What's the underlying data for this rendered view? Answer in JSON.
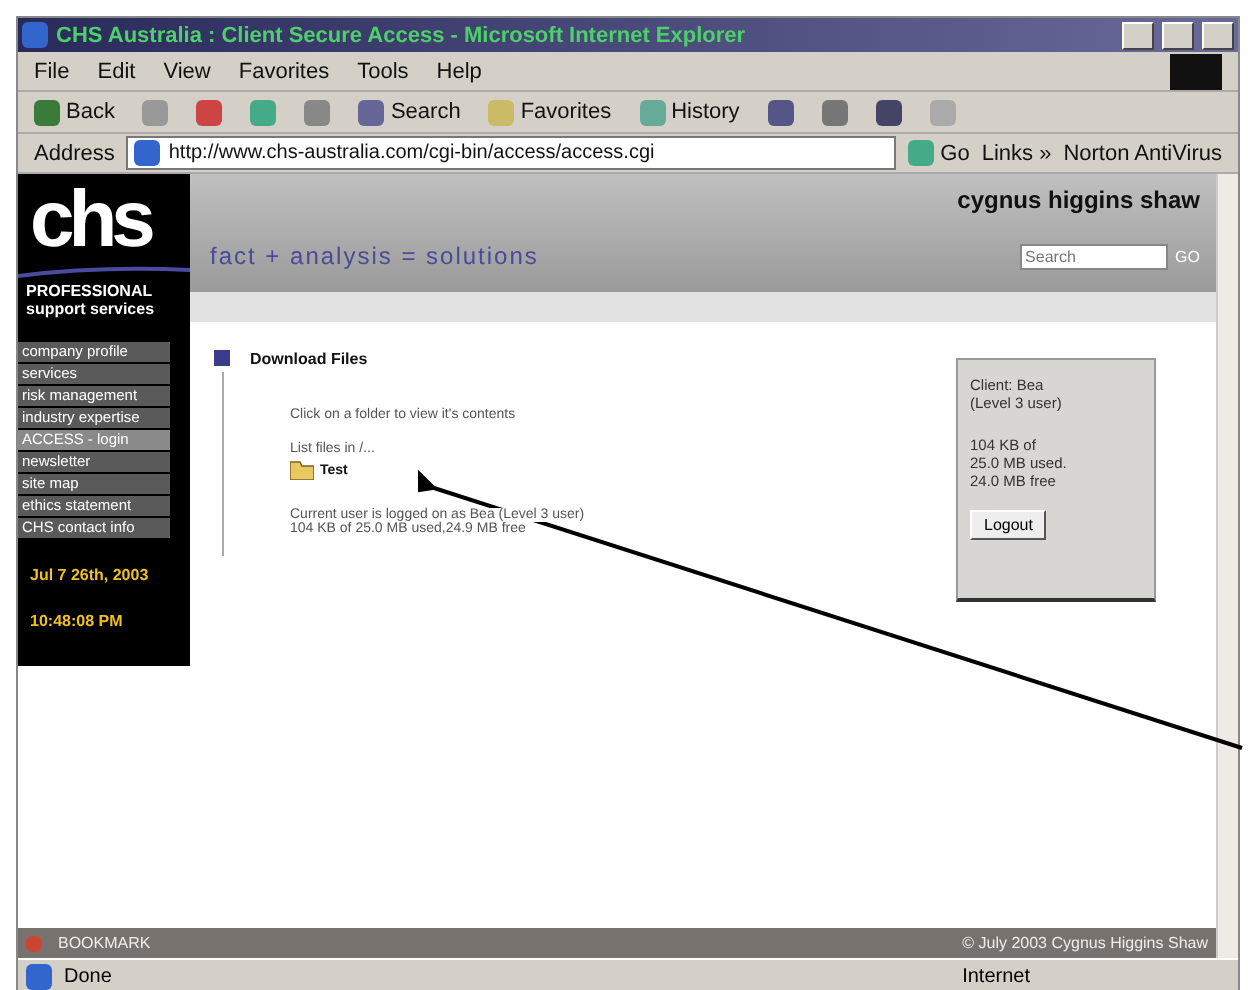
{
  "window": {
    "title": "CHS Australia : Client Secure Access - Microsoft Internet Explorer"
  },
  "menu": [
    "File",
    "Edit",
    "View",
    "Favorites",
    "Tools",
    "Help"
  ],
  "toolbar": [
    {
      "kind": "back",
      "label": "Back"
    },
    {
      "kind": "forward"
    },
    {
      "kind": "stop"
    },
    {
      "kind": "refresh"
    },
    {
      "kind": "home"
    },
    {
      "kind": "search",
      "label": "Search"
    },
    {
      "kind": "favorites",
      "label": "Favorites"
    },
    {
      "kind": "history",
      "label": "History"
    },
    {
      "kind": "mail"
    },
    {
      "kind": "print"
    },
    {
      "kind": "edit"
    },
    {
      "kind": "discuss"
    }
  ],
  "address": {
    "label": "Address",
    "url": "http://www.chs-australia.com/cgi-bin/access/access.cgi",
    "go": "Go",
    "links": "Links",
    "links_more": "»",
    "norton": "Norton AntiVirus"
  },
  "site": {
    "logo": "chs",
    "tagline_1": "PROFESSIONAL",
    "tagline_2": "support services",
    "company": "cygnus higgins shaw",
    "slogan": "fact + analysis = solutions",
    "search_placeholder": "Search",
    "search_button": "GO"
  },
  "nav": [
    {
      "label": "company profile",
      "selected": false
    },
    {
      "label": "services",
      "selected": false
    },
    {
      "label": "risk management",
      "selected": false
    },
    {
      "label": "industry expertise",
      "selected": false
    },
    {
      "label": "ACCESS - login",
      "selected": true
    },
    {
      "label": "newsletter",
      "selected": false
    },
    {
      "label": "site map",
      "selected": false
    },
    {
      "label": "ethics statement",
      "selected": false
    },
    {
      "label": "CHS contact info",
      "selected": false
    }
  ],
  "date": "Jul 7 26th, 2003",
  "time": "10:48:08 PM",
  "content": {
    "heading": "Download Files",
    "instruction": "Click on a folder to view it's contents",
    "listing": "List files in /...",
    "folders": [
      "Test"
    ],
    "user_line": "Current user is logged on as Bea (Level 3 user)",
    "usage_line": "104 KB of 25.0 MB used,24.9 MB free"
  },
  "account": {
    "client": "Client: Bea",
    "level": "(Level 3 user)",
    "usage": [
      "104 KB of",
      "25.0 MB used.",
      "24.0 MB free"
    ],
    "logout": "Logout"
  },
  "footer": {
    "bookmark": "BOOKMARK",
    "copyright": "© July 2003 Cygnus Higgins Shaw"
  },
  "status": {
    "text": "Done",
    "zone": "Internet"
  }
}
